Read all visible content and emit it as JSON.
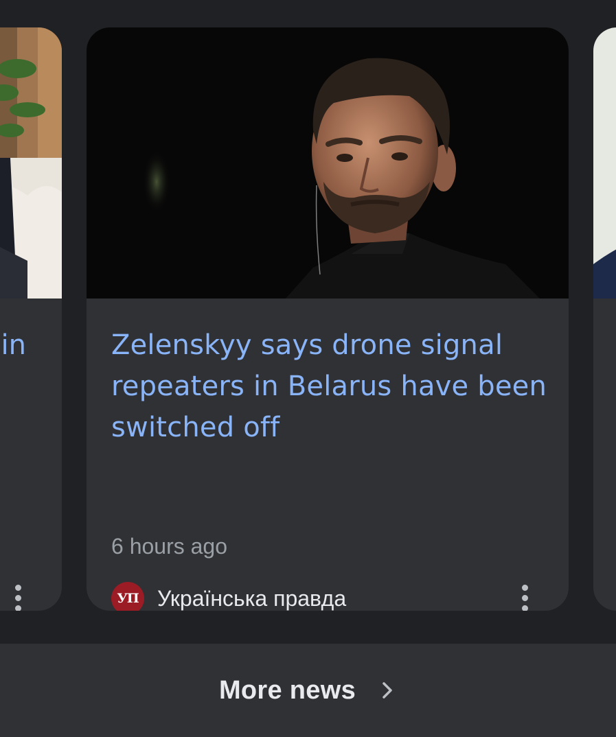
{
  "cards": {
    "left": {
      "headline_fragment": "in"
    },
    "main": {
      "headline": "Zelenskyy says drone signal repeaters in Belarus have been switched off",
      "timestamp": "6 hours ago",
      "source_logo_text": "УП",
      "source_name": "Українська правда",
      "menu_icon": "more-vert-icon"
    }
  },
  "footer": {
    "more_news_label": "More news",
    "chevron_icon": "chevron-right-icon"
  },
  "colors": {
    "background": "#202124",
    "card": "#303134",
    "headline": "#8ab4f8",
    "secondary_text": "#9aa0a6",
    "primary_text": "#e8eaed",
    "source_logo_bg": "#9b1c24"
  }
}
